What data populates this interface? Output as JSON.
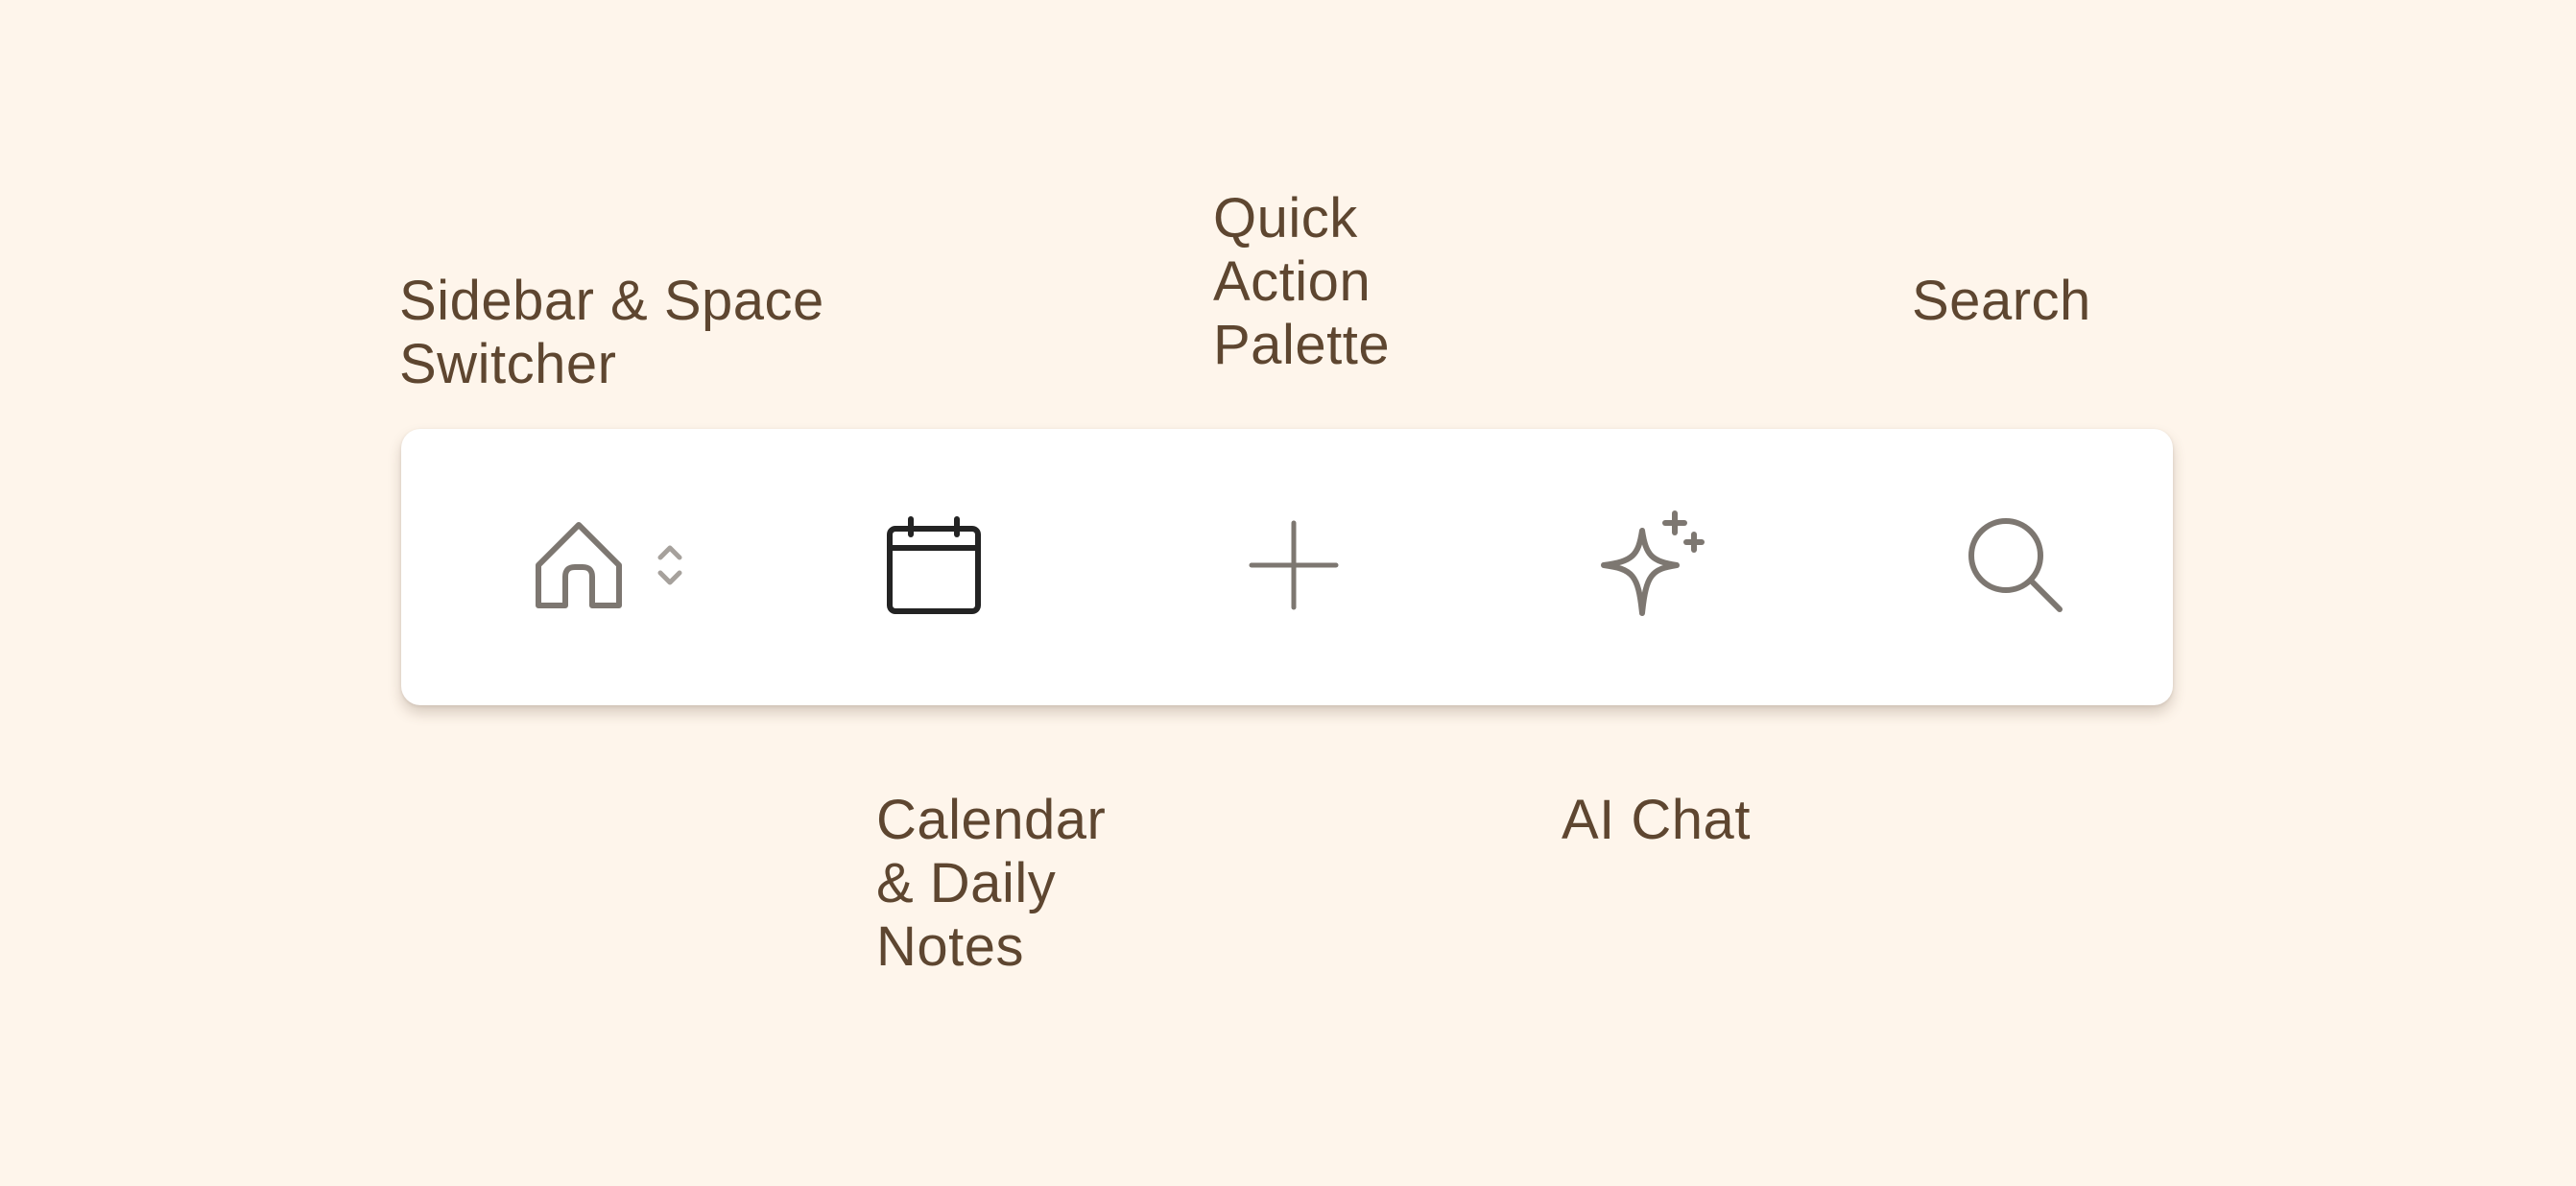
{
  "labels": {
    "sidebar": "Sidebar & Space\nSwitcher",
    "quick_action": "Quick\nAction\nPalette",
    "search": "Search",
    "calendar": "Calendar\n& Daily\nNotes",
    "ai_chat": "AI Chat"
  },
  "toolbar": {
    "buttons": [
      {
        "id": "home",
        "icon": "home-icon",
        "secondary_icon": "chevron-up-down-icon"
      },
      {
        "id": "calendar",
        "icon": "calendar-icon",
        "active": true
      },
      {
        "id": "quick-action",
        "icon": "plus-icon"
      },
      {
        "id": "ai-chat",
        "icon": "sparkles-icon"
      },
      {
        "id": "search",
        "icon": "search-icon"
      }
    ]
  },
  "colors": {
    "background": "#fef5eb",
    "label_text": "#5e4630",
    "icon_default": "#7d7771",
    "icon_active": "#232323",
    "toolbar_bg": "#ffffff"
  }
}
